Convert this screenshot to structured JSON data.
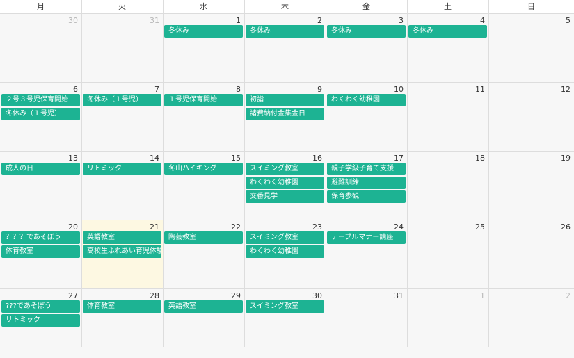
{
  "weekdays": [
    "月",
    "火",
    "水",
    "木",
    "金",
    "土",
    "日"
  ],
  "weeks": [
    {
      "days": [
        {
          "num": "30",
          "other": true,
          "today": false,
          "events": []
        },
        {
          "num": "31",
          "other": true,
          "today": false,
          "events": []
        },
        {
          "num": "1",
          "other": false,
          "today": false,
          "events": [
            "冬休み"
          ]
        },
        {
          "num": "2",
          "other": false,
          "today": false,
          "events": [
            "冬休み"
          ]
        },
        {
          "num": "3",
          "other": false,
          "today": false,
          "events": [
            "冬休み"
          ]
        },
        {
          "num": "4",
          "other": false,
          "today": false,
          "events": [
            "冬休み"
          ]
        },
        {
          "num": "5",
          "other": false,
          "today": false,
          "events": []
        }
      ]
    },
    {
      "days": [
        {
          "num": "6",
          "other": false,
          "today": false,
          "events": [
            "２号３号児保育開始",
            "冬休み（１号児）"
          ]
        },
        {
          "num": "7",
          "other": false,
          "today": false,
          "events": [
            "冬休み（１号児）"
          ]
        },
        {
          "num": "8",
          "other": false,
          "today": false,
          "events": [
            "１号児保育開始"
          ]
        },
        {
          "num": "9",
          "other": false,
          "today": false,
          "events": [
            "初詣",
            "諸費納付金集金日"
          ]
        },
        {
          "num": "10",
          "other": false,
          "today": false,
          "events": [
            "わくわく幼稚園"
          ]
        },
        {
          "num": "11",
          "other": false,
          "today": false,
          "events": []
        },
        {
          "num": "12",
          "other": false,
          "today": false,
          "events": []
        }
      ]
    },
    {
      "days": [
        {
          "num": "13",
          "other": false,
          "today": false,
          "events": [
            "成人の日"
          ]
        },
        {
          "num": "14",
          "other": false,
          "today": false,
          "events": [
            "リトミック"
          ]
        },
        {
          "num": "15",
          "other": false,
          "today": false,
          "events": [
            "冬山ハイキング"
          ]
        },
        {
          "num": "16",
          "other": false,
          "today": false,
          "events": [
            "スイミング教室",
            "わくわく幼稚園",
            "交番見学"
          ]
        },
        {
          "num": "17",
          "other": false,
          "today": false,
          "events": [
            "親子学級子育て支援",
            "避難訓練",
            "保育参観"
          ]
        },
        {
          "num": "18",
          "other": false,
          "today": false,
          "events": []
        },
        {
          "num": "19",
          "other": false,
          "today": false,
          "events": []
        }
      ]
    },
    {
      "days": [
        {
          "num": "20",
          "other": false,
          "today": false,
          "events": [
            "？？？であそぼう",
            "体育教室"
          ]
        },
        {
          "num": "21",
          "other": false,
          "today": true,
          "events": [
            "英語教室",
            "高校生ふれあい育児体験"
          ]
        },
        {
          "num": "22",
          "other": false,
          "today": false,
          "events": [
            "陶芸教室"
          ]
        },
        {
          "num": "23",
          "other": false,
          "today": false,
          "events": [
            "スイミング教室",
            "わくわく幼稚園"
          ]
        },
        {
          "num": "24",
          "other": false,
          "today": false,
          "events": [
            "テーブルマナー講座"
          ]
        },
        {
          "num": "25",
          "other": false,
          "today": false,
          "events": []
        },
        {
          "num": "26",
          "other": false,
          "today": false,
          "events": []
        }
      ]
    },
    {
      "days": [
        {
          "num": "27",
          "other": false,
          "today": false,
          "events": [
            "???であそぼう",
            "リトミック"
          ]
        },
        {
          "num": "28",
          "other": false,
          "today": false,
          "events": [
            "体育教室"
          ]
        },
        {
          "num": "29",
          "other": false,
          "today": false,
          "events": [
            "英語教室"
          ]
        },
        {
          "num": "30",
          "other": false,
          "today": false,
          "events": [
            "スイミング教室"
          ]
        },
        {
          "num": "31",
          "other": false,
          "today": false,
          "events": []
        },
        {
          "num": "1",
          "other": true,
          "today": false,
          "events": []
        },
        {
          "num": "2",
          "other": true,
          "today": false,
          "events": []
        }
      ]
    }
  ],
  "colors": {
    "event_bg": "#1db393",
    "today_bg": "#fdf8e2",
    "cell_bg": "#f7f7f7",
    "grid": "#dddddd"
  }
}
